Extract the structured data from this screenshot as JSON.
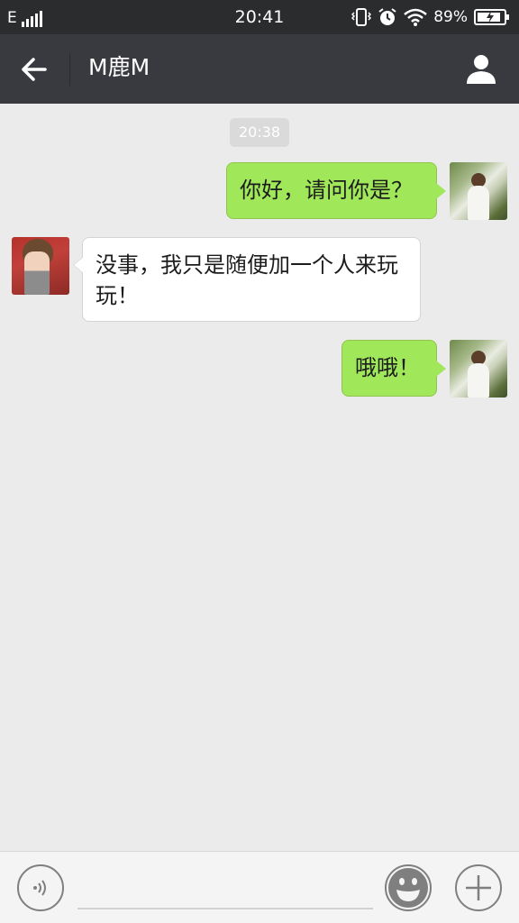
{
  "status_bar": {
    "network": "E",
    "time": "20:41",
    "battery_percent": "89%",
    "battery_level": 0.89,
    "icons": [
      "signal-icon",
      "vibrate-icon",
      "alarm-icon",
      "wifi-icon",
      "battery-charging-icon"
    ]
  },
  "header": {
    "title": "M鹿M",
    "back_icon": "back-arrow-icon",
    "profile_icon": "person-icon"
  },
  "messages": [
    {
      "type": "timestamp",
      "text": "20:38"
    },
    {
      "type": "sent",
      "text": "你好，请问你是？"
    },
    {
      "type": "received",
      "text": "没事，我只是随便加一个人来玩玩！"
    },
    {
      "type": "sent",
      "text": "哦哦！"
    }
  ],
  "input_bar": {
    "voice_icon": "voice-icon",
    "input_value": "",
    "emoji_icon": "emoji-icon",
    "add_icon": "plus-icon"
  },
  "colors": {
    "status_bar": "#2b2c2e",
    "title_bar": "#393a3f",
    "background": "#ebebeb",
    "sent_bubble": "#a0e75a",
    "received_bubble": "#ffffff"
  }
}
